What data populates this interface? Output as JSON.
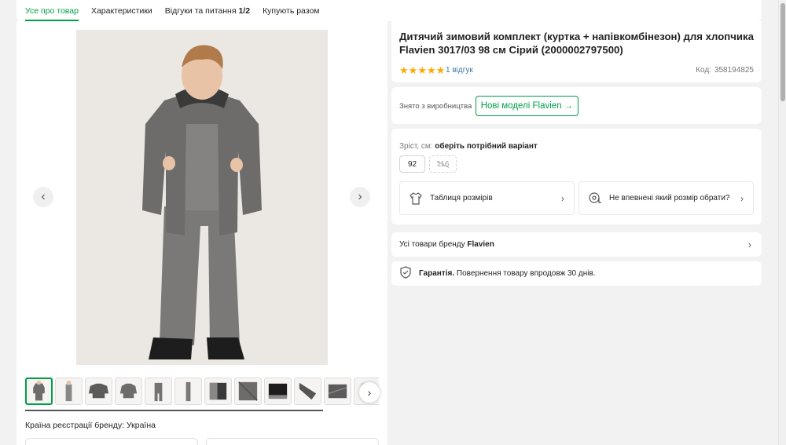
{
  "tabs": [
    {
      "label": "Усе про товар"
    },
    {
      "label": "Характеристики"
    },
    {
      "label": "Відгуки та питання",
      "count": "1/2"
    },
    {
      "label": "Купують разом"
    }
  ],
  "product": {
    "title": "Дитячий зимовий комплект (куртка + напівкомбінезон) для хлопчика Flavien 3017/03 98 см Сірий (2000002797500)",
    "rating": 5,
    "reviews_label": "1 відгук",
    "code_label": "Код:",
    "code_value": "358194825"
  },
  "discontinued": {
    "text": "Знято з виробництва",
    "button_label": "Нові моделі Flavien →"
  },
  "size": {
    "label": "Зріст, см:",
    "prompt": "оберіть потрібний варіант",
    "options": [
      {
        "value": "92",
        "available": true
      },
      {
        "value": "116",
        "available": false
      }
    ]
  },
  "helpers": {
    "size_table": "Таблиця розмірів",
    "size_unsure": "Не впевнені який розмір обрати?"
  },
  "brand_row": {
    "prefix": "Усі товари бренду",
    "brand": "Flavien"
  },
  "guarantee": {
    "bold": "Гарантія.",
    "text": "Повернення товару впродовж 30 днів."
  },
  "gallery": {
    "thumbnail_count": 12,
    "active_index": 0
  },
  "country": {
    "label": "Країна реєстрації бренду:",
    "value": "Україна"
  },
  "colors": {
    "accent": "#00a046",
    "link": "#3e77aa",
    "star": "#ffa900",
    "text": "#221f1f",
    "muted": "#797878"
  }
}
